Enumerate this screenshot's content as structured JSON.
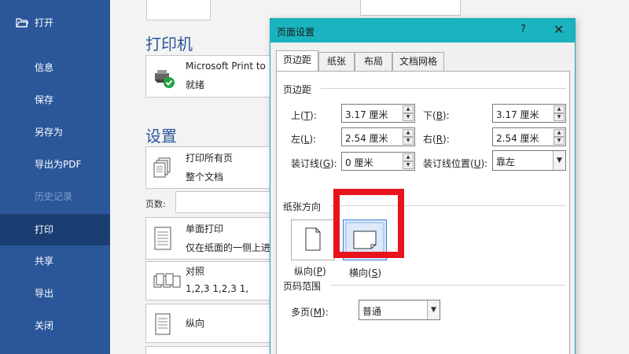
{
  "sidebar": {
    "items": [
      {
        "label": "打开",
        "state": "normal"
      },
      {
        "label": "信息",
        "state": "normal"
      },
      {
        "label": "保存",
        "state": "normal"
      },
      {
        "label": "另存为",
        "state": "normal"
      },
      {
        "label": "导出为PDF",
        "state": "normal"
      },
      {
        "label": "历史记录",
        "state": "disabled"
      },
      {
        "label": "打印",
        "state": "active"
      },
      {
        "label": "共享",
        "state": "normal"
      },
      {
        "label": "导出",
        "state": "normal"
      },
      {
        "label": "关闭",
        "state": "normal"
      }
    ]
  },
  "printer": {
    "section_title": "打印机",
    "name": "Microsoft Print to",
    "status": "就绪"
  },
  "settings": {
    "section_title": "设置",
    "print_range": {
      "line1": "打印所有页",
      "line2": "整个文档"
    },
    "pages_label": "页数:",
    "sides": {
      "line1": "单面打印",
      "line2": "仅在纸面的一侧上进"
    },
    "collate": {
      "line1": "对照",
      "line2": "1,2,3    1,2,3    1,"
    },
    "orientation": {
      "line1": "纵向"
    }
  },
  "dialog": {
    "title": "页面设置",
    "help": "?",
    "close": "✕",
    "tabs": [
      "页边距",
      "纸张",
      "布局",
      "文档网格"
    ],
    "margins_group": "页边距",
    "top_label": "上(",
    "top_key": "T",
    "top_value": "3.17 厘米",
    "bottom_label": "下(",
    "bottom_key": "B",
    "bottom_value": "3.17 厘米",
    "left_label": "左(",
    "left_key": "L",
    "left_value": "2.54 厘米",
    "right_label": "右(",
    "right_key": "R",
    "right_value": "2.54 厘米",
    "gutter_label": "装订线(",
    "gutter_key": "G",
    "gutter_value": "0 厘米",
    "gutter_pos_label": "装订线位置(",
    "gutter_pos_key": "U",
    "gutter_pos_value": "靠左",
    "label_close": "):",
    "orientation_group": "纸张方向",
    "portrait_label": "纵向(",
    "portrait_key": "P",
    "landscape_label": "横向(",
    "landscape_key": "S",
    "paren_close": ")",
    "page_range_group": "页码范围",
    "multiple_pages_label": "多页(",
    "multiple_pages_key": "M",
    "multiple_pages_value": "普通"
  },
  "colors": {
    "sidebar_bg": "#2b579a",
    "sidebar_active": "#1b3e72",
    "title_bar": "#1ab3bf",
    "highlight": "#e8141d"
  }
}
